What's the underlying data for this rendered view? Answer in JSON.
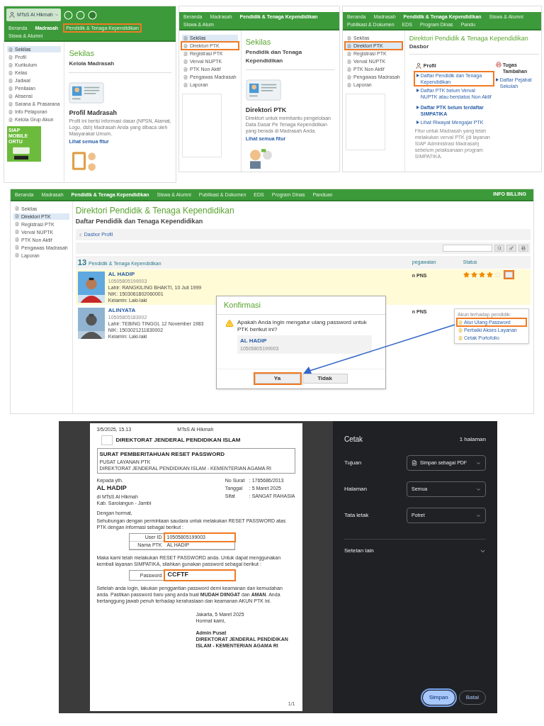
{
  "screen_1": {
    "school": "MTsS Al Hikmah",
    "nav": [
      {
        "label": "Beranda",
        "selected": false,
        "highlighted": false
      },
      {
        "label": "Madrasah",
        "selected": true,
        "highlighted": false
      },
      {
        "label": "Pendidik & Tenaga Kependidikan",
        "selected": false,
        "highlighted": true
      },
      {
        "label": "Siswa & Alumni",
        "selected": false,
        "highlighted": false
      }
    ],
    "sidebar": [
      {
        "label": "Sekilas",
        "selected": true
      },
      {
        "label": "Profil",
        "selected": false
      },
      {
        "label": "Kurikulum",
        "selected": false
      },
      {
        "label": "Kelas",
        "selected": false
      },
      {
        "label": "Jadwal",
        "selected": false
      },
      {
        "label": "Penilaian",
        "selected": false
      },
      {
        "label": "Absensi",
        "selected": false
      },
      {
        "label": "Sarana & Prasarana",
        "selected": false
      },
      {
        "label": "Info Pelaporan",
        "selected": false
      },
      {
        "label": "Kelola Grup Akun",
        "selected": false
      }
    ],
    "ad_title": "SIAP MOBILE ORTU",
    "title": "Sekilas",
    "subtitle": "Kelola Madrasah",
    "card_title": "Profil Madrasah",
    "card_text": "Profil ini berisi informasi dasar (NPSN, Alamat, Logo, dsb) Madrasah Anda yang dibaca oleh Masyarakat Umum.",
    "link": "Lihat semua fitur"
  },
  "screen_2": {
    "nav": [
      {
        "label": "Beranda",
        "selected": false
      },
      {
        "label": "Madrasah",
        "selected": false
      },
      {
        "label": "Pendidik & Tenaga Kependidikan",
        "selected": true
      },
      {
        "label": "Siswa & Alum",
        "selected": false
      }
    ],
    "sidebar": [
      {
        "label": "Sekilas",
        "selected": true,
        "highlighted": false
      },
      {
        "label": "Direktori PTK",
        "selected": false,
        "highlighted": true
      },
      {
        "label": "Registrasi PTK",
        "selected": false,
        "highlighted": false
      },
      {
        "label": "Verval NUPTK",
        "selected": false,
        "highlighted": false
      },
      {
        "label": "PTK Non Aktif",
        "selected": false,
        "highlighted": false
      },
      {
        "label": "Pengawas Madrasah",
        "selected": false,
        "highlighted": false
      },
      {
        "label": "Laporan",
        "selected": false,
        "highlighted": false
      }
    ],
    "title": "Sekilas",
    "subtitle": "Pendidik dan Tenaga Kependidikan",
    "card_title": "Direktori PTK",
    "card_text": "Direktori untuk membantu pengelolaan Data Dasar Pe Tenaga Kependidikan yang berada di Madrasah Anda.",
    "link": "Lihat semua fitur"
  },
  "screen_3": {
    "nav": [
      {
        "label": "Beranda",
        "selected": false
      },
      {
        "label": "Madrasah",
        "selected": false
      },
      {
        "label": "Pendidik & Tenaga Kependidikan",
        "selected": true
      },
      {
        "label": "Siswa & Alumni",
        "selected": false
      },
      {
        "label": "Publikasi & Dokumen",
        "selected": false
      },
      {
        "label": "EDS",
        "selected": false
      },
      {
        "label": "Program Dinas",
        "selected": false
      },
      {
        "label": "Pandu",
        "selected": false
      }
    ],
    "sidebar": [
      {
        "label": "Sekilas",
        "selected": false,
        "highlighted": false
      },
      {
        "label": "Direktori PTK",
        "selected": true,
        "highlighted": true
      },
      {
        "label": "Registrasi PTK",
        "selected": false,
        "highlighted": false
      },
      {
        "label": "Verval NUPTK",
        "selected": false,
        "highlighted": false
      },
      {
        "label": "PTK Non Aktif",
        "selected": false,
        "highlighted": false
      },
      {
        "label": "Pengawas Madrasah",
        "selected": false,
        "highlighted": false
      },
      {
        "label": "Laporan",
        "selected": false,
        "highlighted": false
      }
    ],
    "title": "Direktori Pendidik & Tenaga Kependidikan",
    "subtitle": "Dasbor",
    "section": "Profil",
    "links": [
      {
        "label": "Daftar Pendidik dan Tenaga Kependidikan",
        "highlighted": true,
        "bold": false
      },
      {
        "label": "Daftar PTK belum Verval NUPTK atau berstatus Non Aktif",
        "highlighted": false,
        "bold": false
      },
      {
        "label": "Daftar PTK belum terdaftar SIMPATIKA",
        "highlighted": false,
        "bold": true
      },
      {
        "label": "Lihat Riwayat Mengajar PTK",
        "highlighted": false,
        "bold": false
      }
    ],
    "note": "Fitur untuk Madrasah yang telah melakukan verval PTK (di layanan SIAP Administrasi Madrasah) sebelum pelaksanaan program SIMPATIKA.",
    "side_title": "Tugas Tambahan",
    "side_link": "Daftar Pejabat Sekolah"
  },
  "screen_4": {
    "nav": [
      {
        "label": "Beranda",
        "selected": false
      },
      {
        "label": "Madrasah",
        "selected": false
      },
      {
        "label": "Pendidik & Tenaga Kependidikan",
        "selected": true
      },
      {
        "label": "Siswa & Alumni",
        "selected": false
      },
      {
        "label": "Publikasi & Dokumen",
        "selected": false
      },
      {
        "label": "EDS",
        "selected": false
      },
      {
        "label": "Program Dinas",
        "selected": false
      },
      {
        "label": "Panduan",
        "selected": false
      }
    ],
    "billing": "INFO BILLING",
    "sidebar": [
      {
        "label": "Sekilas",
        "selected": false
      },
      {
        "label": "Direktori PTK",
        "selected": true
      },
      {
        "label": "Registrasi PTK",
        "selected": false
      },
      {
        "label": "Verval NUPTK",
        "selected": false
      },
      {
        "label": "PTK Non Aktif",
        "selected": false
      },
      {
        "label": "Pengawas Madrasah",
        "selected": false
      },
      {
        "label": "Laporan",
        "selected": false
      }
    ],
    "title": "Direktori Pendidik & Tenaga Kependidikan",
    "subtitle": "Daftar Pendidik dan Tenaga Kependidikan",
    "breadcrumb": "Dasbor Profil",
    "count": "13",
    "count_label": "Pendidik & Tenaga Kependidikan",
    "column_2": "pegawaian",
    "column_3": "Status",
    "rows": [
      {
        "name": "AL HADIP",
        "id": "10505805199003",
        "birth": "Lahir: RANGKILING BHAKTI, 10 Juli 1999",
        "nik": "NIK: 1503061802060001",
        "gender": "Kelamin: Laki-laki",
        "status": "n PNS",
        "selected": true,
        "stars": 4
      },
      {
        "name": "ALINYATA",
        "id": "10505805183002",
        "birth": "Lahir: TEBING TINGGI, 12 November 1983",
        "nik": "NIK: 1503021211830002",
        "gender": "Kelamin: Laki-laki",
        "status": "n PNS",
        "selected": false
      }
    ],
    "menu": {
      "header": "Akun terhadap pendidik:",
      "items": [
        {
          "label": "Atur Ulang Password",
          "highlighted": true
        },
        {
          "label": "Perbaiki Akses Layanan",
          "highlighted": false
        },
        {
          "label": "Cetak Portofolio",
          "highlighted": false
        }
      ]
    },
    "dialog": {
      "title": "Konfirmasi",
      "message": "Apakah Anda ingin mengatur ulang password untuk PTK berikut ini?",
      "name": "AL HADIP",
      "id": "10505805199003",
      "buttons": [
        {
          "label": "Ya",
          "highlighted": true
        },
        {
          "label": "Tidak",
          "highlighted": false
        }
      ]
    }
  },
  "print_preview": {
    "document": {
      "timestamp": "3/5/2025, 15.13",
      "header_title": "MTsS Al Hikmah",
      "org": "DIREKTORAT JENDERAL PENDIDIKAN ISLAM",
      "letter_title": "SURAT PEMBERITAHUAN RESET PASSWORD",
      "letter_sub": "PUSAT LAYANAN PTK",
      "letter_org": "DIREKTORAT JENDERAL PENDIDIKAN ISLAM - KEMENTERIAN AGAMA RI",
      "to_label": "Kepada yth.",
      "to_name": "AL HADIP",
      "to_place": "di MTsS Al Hikmah",
      "to_region": "Kab. Sarolangun - Jambi",
      "meta": [
        {
          "label": "No Surat",
          "value": ": 1765686/2013"
        },
        {
          "label": "Tanggal",
          "value": ": 5 Maret 2025"
        },
        {
          "label": "Sifat",
          "value": ": SANGAT RAHASIA"
        }
      ],
      "greeting": "Dengan hormat,",
      "intro": "Sehubungan dengan permintaan saudara untuk melakukan RESET PASSWORD atas PTK dengan informasi sebagai berikut :",
      "info": [
        {
          "label": "User ID",
          "value": "10505805199003",
          "highlighted": true
        },
        {
          "label": "Nama PTK",
          "value": "AL HADIP",
          "highlighted": false
        }
      ],
      "body": "Maka kami telah melakukan RESET PASSWORD anda. Untuk dapat menggunakan kembali layanan SIMPATIKA, silahkan gunakan password sebagai berikut :",
      "password_label": "Password",
      "password": "CCFTF",
      "advice": "Setelah anda login, lakukan penggantian password demi keamanan dan kemudahan anda. Pastikan password baru yang anda buat **MUDAH DIINGAT** dan **AMAN**. Anda bertanggung jawab penuh terhadap kerahasiaan dan keamanan AKUN PTK ini.",
      "place_date": "Jakarta, 5 Maret 2025",
      "closing": "Hormat kami,",
      "signer": "Admin Pusat",
      "signer_org": "DIREKTORAT JENDERAL PENDIDIKAN ISLAM - KEMENTERIAN AGAMA RI",
      "page": "1/1"
    },
    "panel": {
      "title": "Cetak",
      "pages": "1 halaman",
      "settings": [
        {
          "label": "Tujuan",
          "value": "Simpan sebagai PDF"
        },
        {
          "label": "Halaman",
          "value": "Semua"
        },
        {
          "label": "Tata letak",
          "value": "Potret"
        }
      ],
      "more": "Setelan lain",
      "buttons": [
        {
          "label": "Simpan",
          "primary": true
        },
        {
          "label": "Batal",
          "primary": false
        }
      ]
    }
  }
}
